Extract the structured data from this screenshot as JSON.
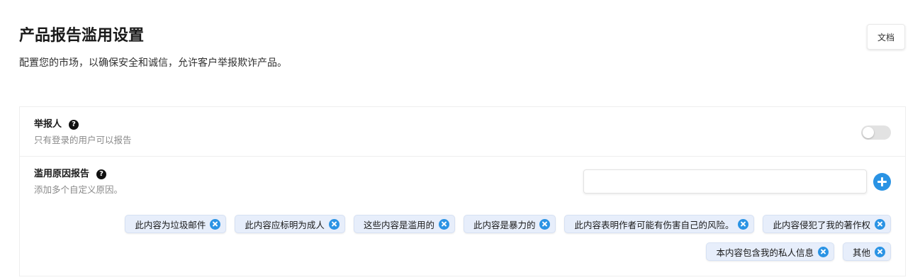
{
  "header": {
    "title": "产品报告滥用设置",
    "subtitle": "配置您的市场，以确保安全和诚信，允许客户举报欺诈产品。",
    "docs_label": "文档"
  },
  "reporter": {
    "label": "举报人",
    "description": "只有登录的用户可以报告",
    "toggle_on": false
  },
  "abuse_reasons": {
    "label": "滥用原因报告",
    "description": "添加多个自定义原因。",
    "input_value": "",
    "add_icon": "plus-circle-icon",
    "tags": [
      {
        "label": "此内容为垃圾邮件"
      },
      {
        "label": "此内容应标明为成人"
      },
      {
        "label": "这些内容是滥用的"
      },
      {
        "label": "此内容是暴力的"
      },
      {
        "label": "此内容表明作者可能有伤害自己的风险。"
      },
      {
        "label": "此内容侵犯了我的著作权"
      },
      {
        "label": "本内容包含我的私人信息"
      },
      {
        "label": "其他"
      }
    ]
  },
  "colors": {
    "accent": "#2a93e4",
    "tag_background": "#e7eefb",
    "toggle_off": "#e2e2e2"
  }
}
